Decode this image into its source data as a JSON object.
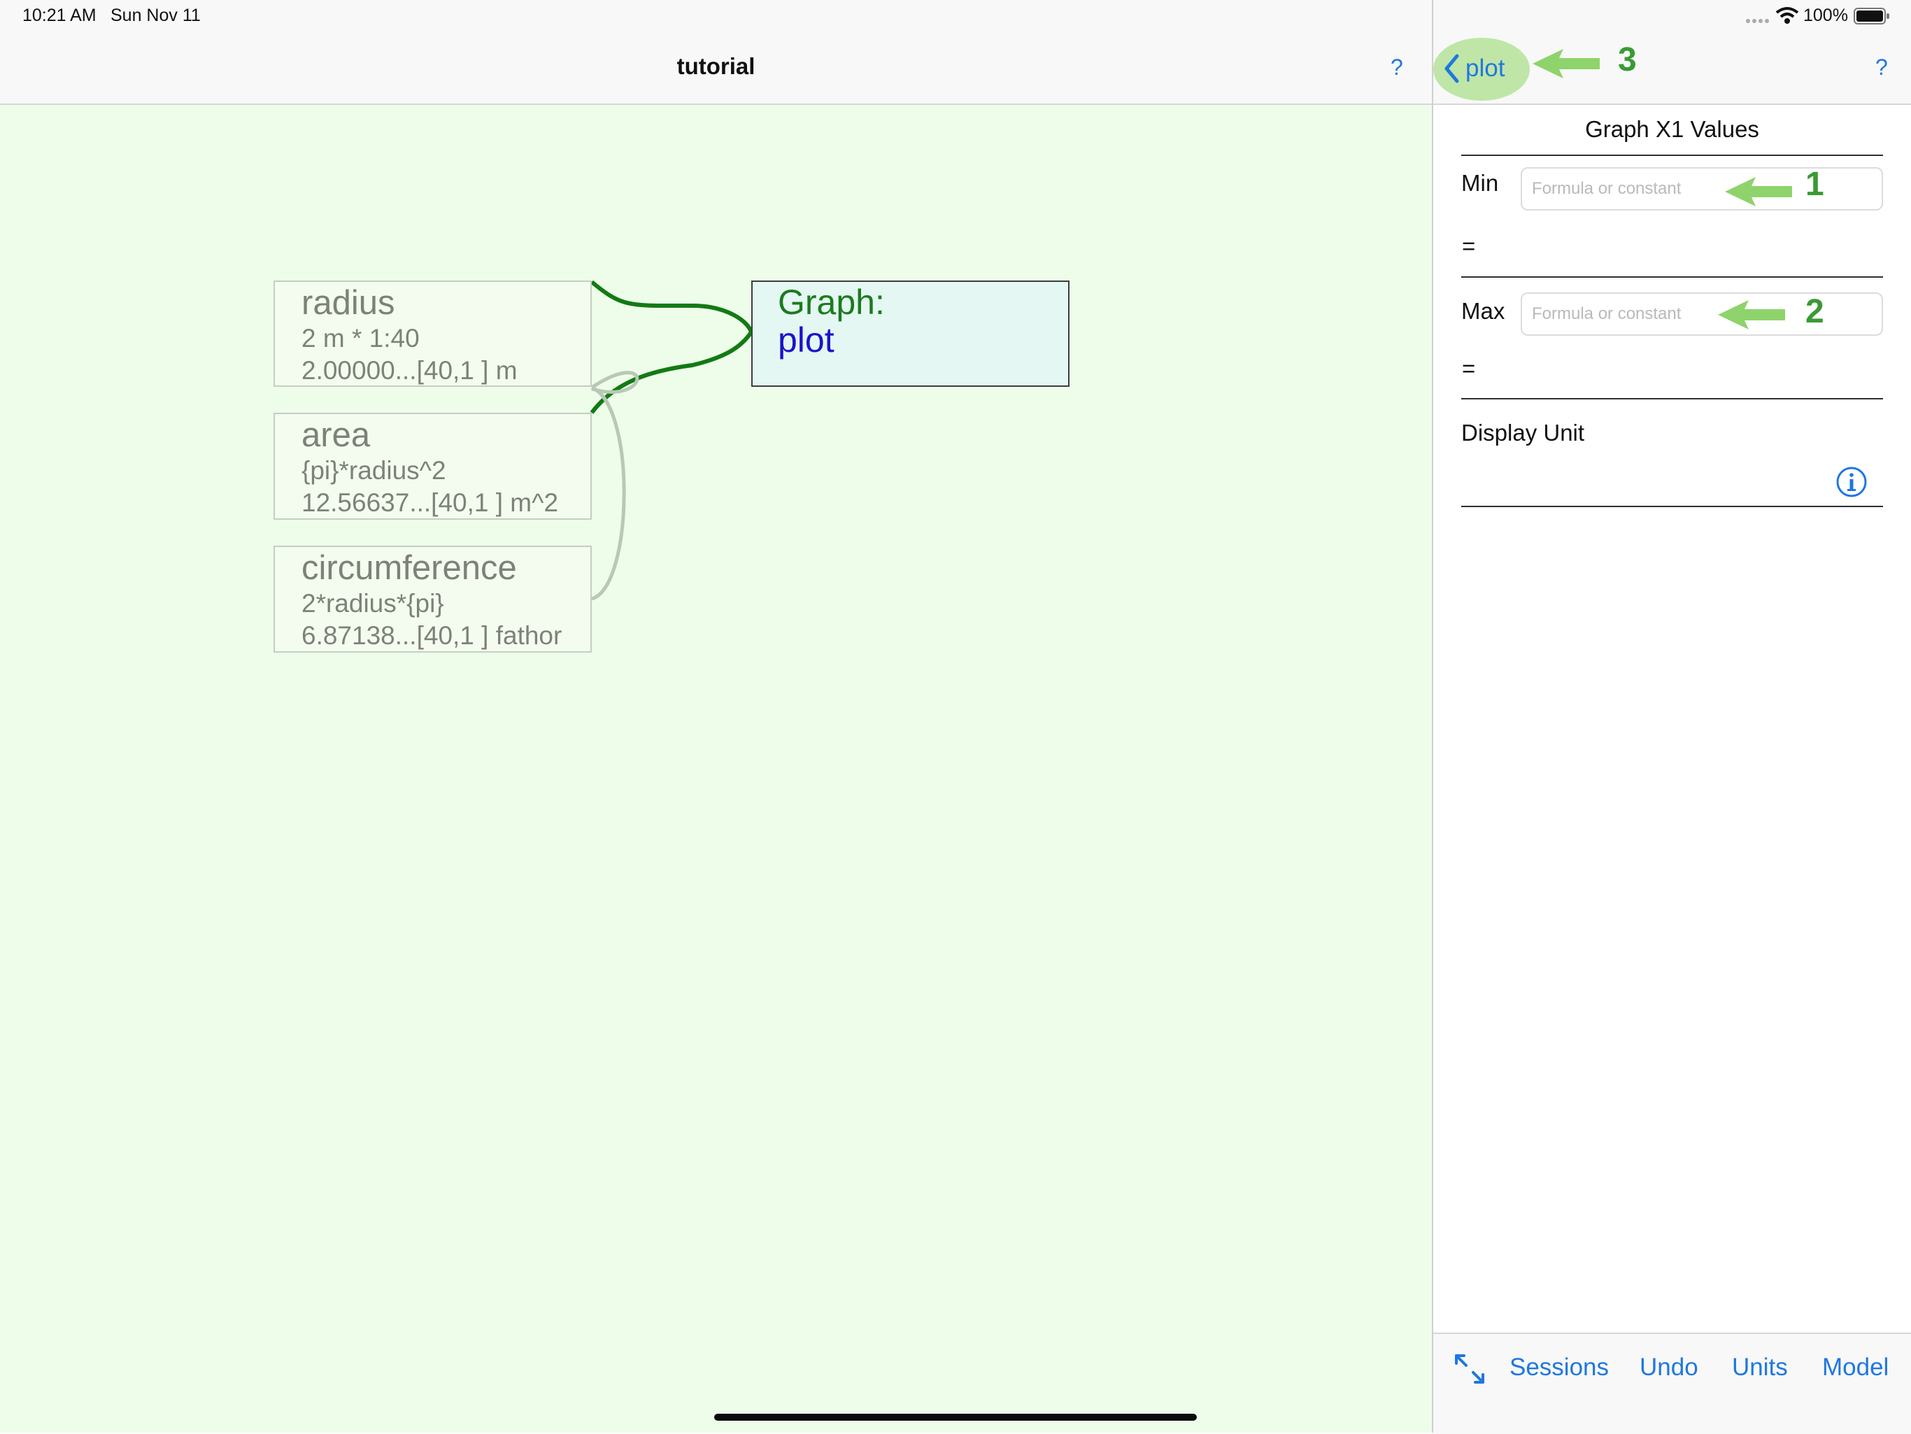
{
  "status_bar": {
    "time": "10:21 AM",
    "date": "Sun Nov 11",
    "battery": "100%"
  },
  "left_nav": {
    "title": "tutorial",
    "help_label": "?"
  },
  "right_nav": {
    "back_label": "plot",
    "help_label": "?",
    "annotation": "3"
  },
  "canvas": {
    "nodes": [
      {
        "name": "radius",
        "formula": "2 m * 1:40",
        "value": "2.00000...[40,1 ] m"
      },
      {
        "name": "area",
        "formula": "{pi}*radius^2",
        "value": "12.56637...[40,1 ] m^2"
      },
      {
        "name": "circumference",
        "formula": "2*radius*{pi}",
        "value": "6.87138...[40,1 ] fathor"
      }
    ],
    "graph_node": {
      "title": "Graph:",
      "name": "plot"
    }
  },
  "panel": {
    "heading": "Graph X1 Values",
    "min_label": "Min",
    "min_placeholder": "Formula or constant",
    "min_equals": "=",
    "min_annotation": "1",
    "max_label": "Max",
    "max_placeholder": "Formula or constant",
    "max_equals": "=",
    "max_annotation": "2",
    "display_unit_label": "Display Unit"
  },
  "toolbar": {
    "sessions_label": "Sessions",
    "undo_label": "Undo",
    "units_label": "Units",
    "model_label": "Model"
  },
  "colors": {
    "canvas_bg": "#edfdea",
    "accent_blue": "#1f77e0",
    "link_green": "#137a13",
    "annotation_green": "#8ed36b"
  }
}
